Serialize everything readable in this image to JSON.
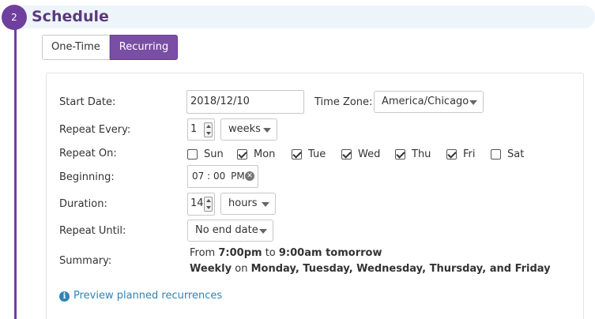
{
  "step": {
    "number": "2",
    "title": "Schedule"
  },
  "mode_toggle": {
    "one_time": "One-Time",
    "recurring": "Recurring",
    "selected": "Recurring"
  },
  "colors": {
    "accent": "#7a4ea5",
    "header_band": "#eef5fa",
    "link": "#2f83b7"
  },
  "form": {
    "start_date": {
      "label": "Start Date:",
      "value": "2018/12/10"
    },
    "time_zone": {
      "label": "Time Zone:",
      "value": "America/Chicago"
    },
    "repeat_every": {
      "label": "Repeat Every:",
      "value": "1",
      "unit": "weeks"
    },
    "repeat_on": {
      "label": "Repeat On:",
      "days": [
        {
          "name": "Sun",
          "checked": false
        },
        {
          "name": "Mon",
          "checked": true
        },
        {
          "name": "Tue",
          "checked": true
        },
        {
          "name": "Wed",
          "checked": true
        },
        {
          "name": "Thu",
          "checked": true
        },
        {
          "name": "Fri",
          "checked": true
        },
        {
          "name": "Sat",
          "checked": false
        }
      ]
    },
    "beginning": {
      "label": "Beginning:",
      "hour": "07",
      "separator": ":",
      "minute": "00",
      "ampm": "PM"
    },
    "duration": {
      "label": "Duration:",
      "value": "14",
      "unit": "hours"
    },
    "repeat_until": {
      "label": "Repeat Until:",
      "value": "No end date"
    },
    "summary": {
      "label": "Summary:",
      "line1": {
        "from": "From",
        "start": "7:00pm",
        "to": "to",
        "end": "9:00am tomorrow"
      },
      "line2": {
        "frequency": "Weekly",
        "on": "on",
        "days": "Monday, Tuesday, Wednesday, Thursday, and Friday"
      }
    }
  },
  "preview_link": "Preview planned recurrences"
}
